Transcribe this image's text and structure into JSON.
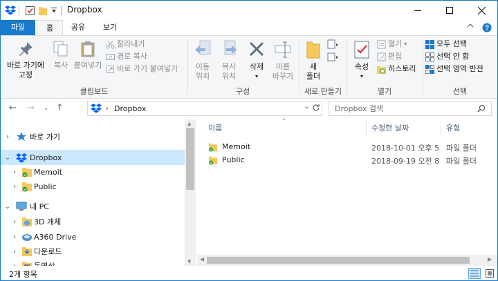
{
  "window": {
    "title": "Dropbox",
    "controls": {
      "minimize": "minimize",
      "maximize": "maximize",
      "close": "close"
    }
  },
  "ribbon_tabs": [
    {
      "label": "파일"
    },
    {
      "label": "홈"
    },
    {
      "label": "공유"
    },
    {
      "label": "보기"
    }
  ],
  "ribbon": {
    "clipboard": {
      "pin_line1": "바로 가기에",
      "pin_line2": "고정",
      "copy": "복사",
      "paste": "붙여넣기",
      "cut": "잘라내기",
      "copy_path": "경로 복사",
      "paste_shortcut": "바로 가기 붙여넣기",
      "group": "클립보드"
    },
    "organize": {
      "move_line1": "이동",
      "move_line2": "위치",
      "copyto_line1": "복사",
      "copyto_line2": "위치",
      "delete": "삭제",
      "rename_line1": "이름",
      "rename_line2": "바꾸기",
      "group": "구성"
    },
    "new": {
      "folder_line1": "새",
      "folder_line2": "폴더",
      "group": "새로 만들기"
    },
    "open": {
      "properties": "속성",
      "open": "열기",
      "edit": "편집",
      "history": "히스토리",
      "group": "열기"
    },
    "select": {
      "select_all": "모두 선택",
      "select_none": "선택 안 함",
      "invert": "선택 영역 반전",
      "group": "선택"
    }
  },
  "address": {
    "path": "Dropbox",
    "search_placeholder": "Dropbox 검색"
  },
  "nav_tree": [
    {
      "label": "바로 가기"
    },
    {
      "label": "Dropbox"
    },
    {
      "label": "Memoit"
    },
    {
      "label": "Public"
    },
    {
      "label": "내 PC"
    },
    {
      "label": "3D 개체"
    },
    {
      "label": "A360 Drive"
    },
    {
      "label": "다운로드"
    },
    {
      "label": "동영상"
    }
  ],
  "columns": {
    "name": "이름",
    "date": "수정한 날짜",
    "type": "유형"
  },
  "files": [
    {
      "name": "Memoit",
      "date": "2018-10-01 오후 5",
      "type": "파일 폴더"
    },
    {
      "name": "Public",
      "date": "2018-09-19 오전 8",
      "type": "파일 폴더"
    }
  ],
  "status": {
    "item_count": "2개 항목"
  },
  "colors": {
    "accent": "#1979ca",
    "selection": "#cce8ff",
    "folder": "#f7c95a",
    "sync_green": "#2e9a3e"
  }
}
